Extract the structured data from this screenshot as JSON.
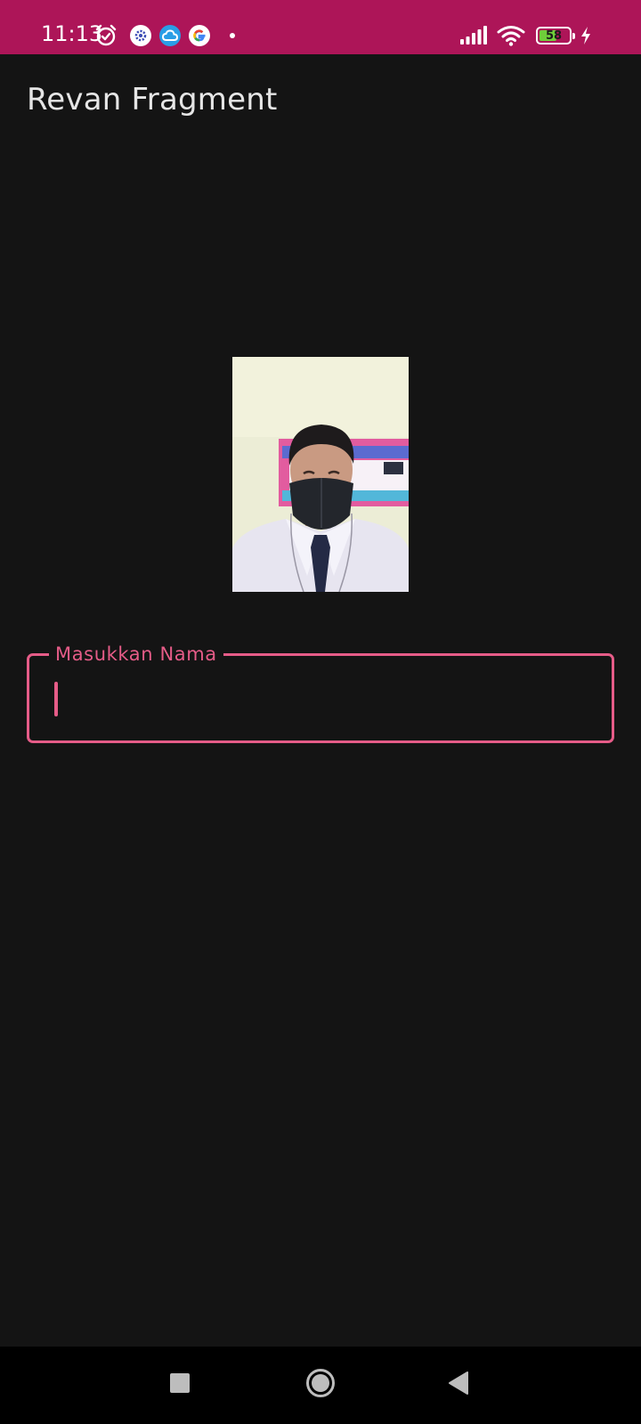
{
  "status_bar": {
    "time": "11:13",
    "battery_level": 58,
    "battery_text": "58",
    "background_color": "#ad1558",
    "icons_left": [
      "alarm-icon",
      "settings-notification-icon",
      "cloud-notification-icon",
      "google-icon",
      "more-notifications-dot-icon"
    ],
    "icons_right": [
      "signal-icon",
      "wifi-icon",
      "battery-icon",
      "charging-icon"
    ]
  },
  "app_bar": {
    "title": "Revan Fragment"
  },
  "main": {
    "name_field": {
      "label": "Masukkan Nama",
      "value": "",
      "accent_color": "#e65c88"
    }
  },
  "nav_bar": {
    "buttons": [
      "recents-icon",
      "home-icon",
      "back-icon"
    ]
  }
}
